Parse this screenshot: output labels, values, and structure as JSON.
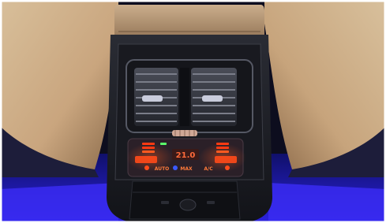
{
  "climate_panel": {
    "temperature": "21.0",
    "mode_label": "AUTO",
    "max_label": "MAX",
    "ac_label": "A/C"
  },
  "colors": {
    "ambient": "#2a1fd8",
    "leather": "#c8a882",
    "console": "#1b1c22",
    "indicator": "#ff3a12",
    "display": "#ff5a36"
  }
}
